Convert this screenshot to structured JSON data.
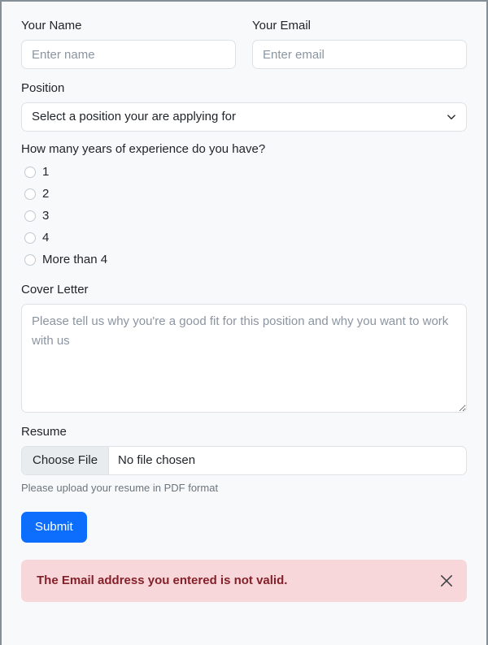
{
  "form": {
    "name_field": {
      "label": "Your Name",
      "placeholder": "Enter name",
      "value": ""
    },
    "email_field": {
      "label": "Your Email",
      "placeholder": "Enter email",
      "value": ""
    },
    "position_field": {
      "label": "Position",
      "selected": "Select a position your are applying for",
      "icon": "chevron-down-icon"
    },
    "experience_field": {
      "question": "How many years of experience do you have?",
      "options": [
        {
          "label": "1",
          "checked": false
        },
        {
          "label": "2",
          "checked": false
        },
        {
          "label": "3",
          "checked": false
        },
        {
          "label": "4",
          "checked": false
        },
        {
          "label": "More than 4",
          "checked": false
        }
      ]
    },
    "cover_letter_field": {
      "label": "Cover Letter",
      "placeholder": "Please tell us why you're a good fit for this position and why you want to work with us",
      "value": ""
    },
    "resume_field": {
      "label": "Resume",
      "button_label": "Choose File",
      "file_status": "No file chosen",
      "help_text": "Please upload your resume in PDF format"
    },
    "submit_button": {
      "label": "Submit"
    },
    "alert": {
      "message": "The Email address you entered is not valid.",
      "close_icon": "close-icon",
      "background_color": "#f8d7da",
      "text_color": "#842029"
    }
  },
  "theme": {
    "primary_color": "#0d6efd",
    "page_background": "#f8f9fa",
    "border_color": "#dee2e6",
    "muted_text_color": "#6c757d",
    "text_color": "#212529"
  }
}
